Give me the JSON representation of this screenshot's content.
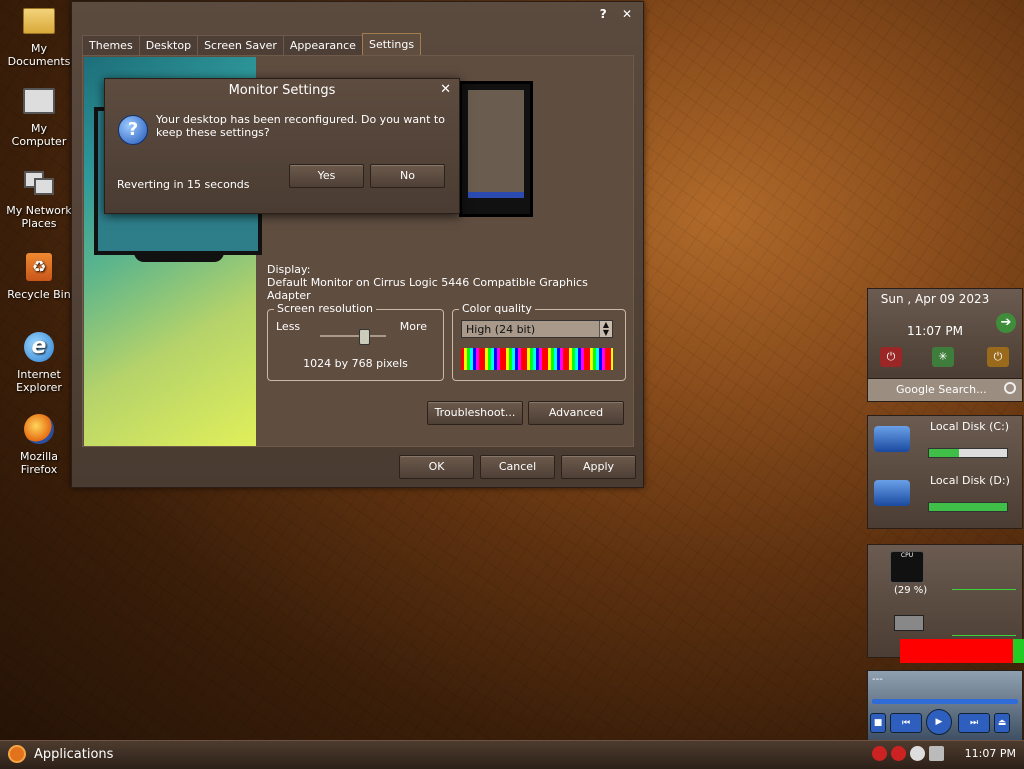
{
  "desktop": {
    "icons": [
      {
        "label": "My\nDocuments",
        "icon": "folder-icon"
      },
      {
        "label": "My\nComputer",
        "icon": "computer-icon"
      },
      {
        "label": "My Network\nPlaces",
        "icon": "network-icon"
      },
      {
        "label": "Recycle Bin",
        "icon": "recycle-bin-icon"
      },
      {
        "label": "Internet\nExplorer",
        "icon": "internet-explorer-icon"
      },
      {
        "label": "Mozilla\nFirefox",
        "icon": "firefox-icon"
      }
    ]
  },
  "window": {
    "controls": {
      "help": "?",
      "close": "✕"
    },
    "tabs": [
      "Themes",
      "Desktop",
      "Screen Saver",
      "Appearance",
      "Settings"
    ],
    "active_tab": "Settings",
    "display_label": "Display:",
    "display_value": "Default Monitor on Cirrus Logic 5446 Compatible Graphics Adapter",
    "screen_resolution": {
      "title": "Screen resolution",
      "less": "Less",
      "more": "More",
      "value": "1024 by 768 pixels",
      "slider_position": 0.65
    },
    "color_quality": {
      "title": "Color quality",
      "selected": "High (24 bit)"
    },
    "buttons": {
      "troubleshoot": "Troubleshoot...",
      "advanced": "Advanced",
      "ok": "OK",
      "cancel": "Cancel",
      "apply": "Apply"
    }
  },
  "dialog": {
    "title": "Monitor Settings",
    "close": "✕",
    "message": "Your desktop has been reconfigured.  Do you want to keep these settings?",
    "revert": "Reverting in 15 seconds",
    "yes": "Yes",
    "no": "No"
  },
  "gadgets": {
    "clock": {
      "date": "Sun , Apr 09 2023",
      "time": "11:07 PM"
    },
    "search": {
      "placeholder": "Google Search..."
    },
    "disks": [
      {
        "label": "Local Disk (C:)",
        "usage": 0.38
      },
      {
        "label": "Local Disk (D:)",
        "usage": 1.0
      }
    ],
    "cpu": {
      "percent": "(29 %)",
      "gauge_text": "CPU"
    },
    "media": {
      "title": "---"
    }
  },
  "taskbar": {
    "start_label": "Applications",
    "time": "11:07 PM"
  },
  "colors": {
    "accent": "#a47d4e",
    "window_bg": "#5f4d40",
    "disk_fill": "#3fbf47",
    "mem_bar": "#ff0000"
  }
}
